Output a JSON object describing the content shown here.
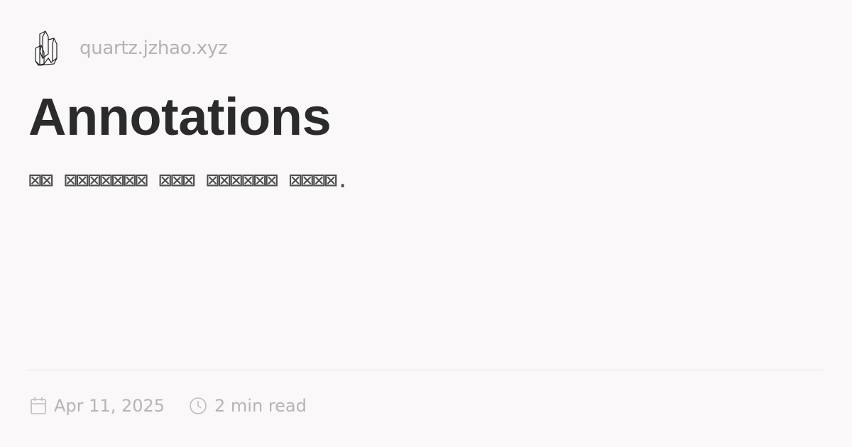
{
  "header": {
    "logo_icon": "quartz-crystal-icon",
    "site": "quartz.jzhao.xyz"
  },
  "title": "Annotations",
  "description": "⊠⊠ ⊠⊠⊠⊠⊠⊠⊠ ⊠⊠⊠ ⊠⊠⊠⊠⊠⊠ ⊠⊠⊠⊠.",
  "footer": {
    "date_icon": "calendar-icon",
    "date": "Apr 11, 2025",
    "reading_icon": "clock-icon",
    "reading_time": "2 min read"
  },
  "colors": {
    "background": "#faf8f8",
    "title": "#2b2b2b",
    "muted": "#b5b5b5"
  }
}
